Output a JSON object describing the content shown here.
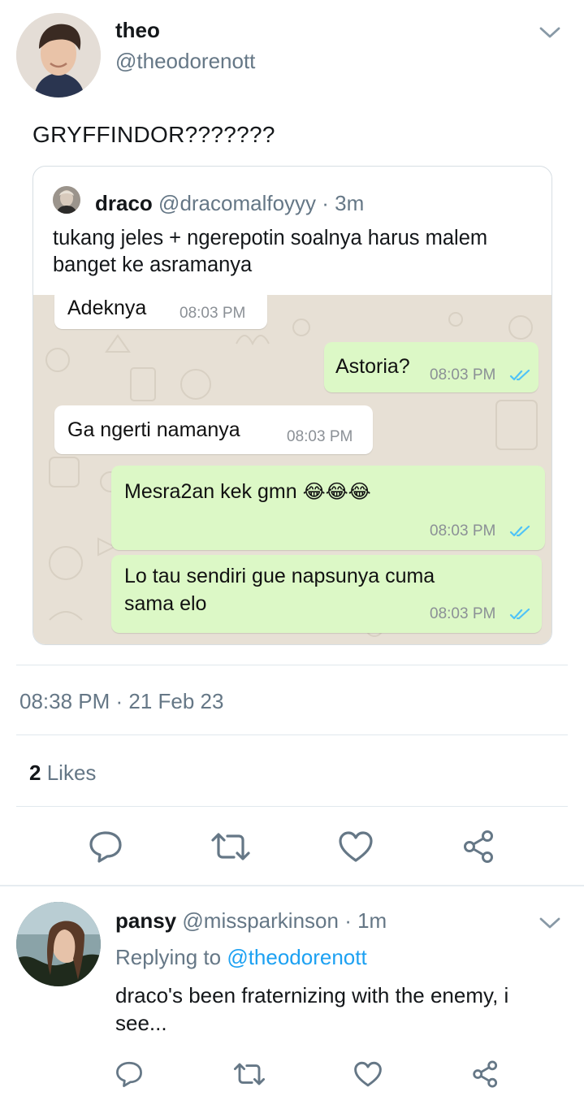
{
  "tweet": {
    "name": "theo",
    "handle": "@theodorenott",
    "text": "GRYFFINDOR???????",
    "timestamp": "08:38 PM · 21 Feb 23",
    "likes_count": "2",
    "likes_label": "Likes"
  },
  "quote": {
    "name": "draco",
    "handle": "@dracomalfoyyy",
    "time": "· 3m",
    "text": "tukang jeles + ngerepotin soalnya harus malem banget ke asramanya"
  },
  "chat": {
    "messages": [
      {
        "dir": "in",
        "text": "Adeknya",
        "time": "08:03 PM"
      },
      {
        "dir": "out",
        "text": "Astoria?",
        "time": "08:03 PM"
      },
      {
        "dir": "in",
        "text": "Ga ngerti namanya",
        "time": "08:03 PM"
      },
      {
        "dir": "out",
        "text": "Mesra2an kek gmn",
        "emoji": "😂😂😂",
        "time": "08:03 PM"
      },
      {
        "dir": "out",
        "text_line1": "Lo tau sendiri gue napsunya cuma",
        "text_line2": "sama elo",
        "time": "08:03 PM"
      }
    ]
  },
  "reply": {
    "name": "pansy",
    "handle": "@missparkinson",
    "time": "· 1m",
    "replying_prefix": "Replying to",
    "replying_mention": "@theodorenott",
    "text": "draco's been fraternizing with the enemy, i see..."
  },
  "icons": {
    "reply": "reply-icon",
    "retweet": "retweet-icon",
    "like": "heart-icon",
    "share": "share-icon",
    "chevron": "chevron-down-icon",
    "read_ticks": "double-check-icon"
  },
  "colors": {
    "secondary_text": "#657786",
    "link": "#1da1f2",
    "ticks": "#4fc3f7",
    "outgoing_bubble": "#dcf8c6",
    "chat_background": "#e7e0d5"
  }
}
